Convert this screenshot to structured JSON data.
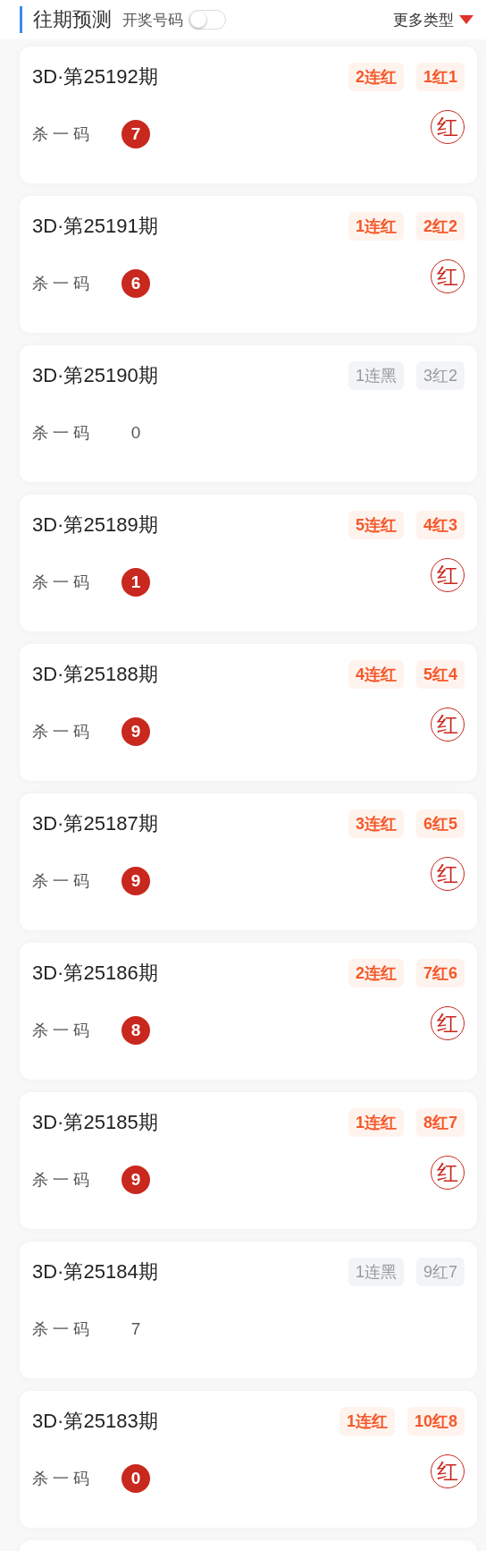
{
  "header": {
    "title": "往期预测",
    "toggle": {
      "label": "开奖号码",
      "on": false
    },
    "more_menu": "更多类型"
  },
  "cards": [
    {
      "title": "3D·第25192期",
      "badges": [
        "2连红",
        "1红1"
      ],
      "hit": true,
      "label": "杀 一 码",
      "number": "7",
      "stamp": "红"
    },
    {
      "title": "3D·第25191期",
      "badges": [
        "1连红",
        "2红2"
      ],
      "hit": true,
      "label": "杀 一 码",
      "number": "6",
      "stamp": "红"
    },
    {
      "title": "3D·第25190期",
      "badges": [
        "1连黑",
        "3红2"
      ],
      "hit": false,
      "label": "杀 一 码",
      "number": "0"
    },
    {
      "title": "3D·第25189期",
      "badges": [
        "5连红",
        "4红3"
      ],
      "hit": true,
      "label": "杀 一 码",
      "number": "1",
      "stamp": "红"
    },
    {
      "title": "3D·第25188期",
      "badges": [
        "4连红",
        "5红4"
      ],
      "hit": true,
      "label": "杀 一 码",
      "number": "9",
      "stamp": "红"
    },
    {
      "title": "3D·第25187期",
      "badges": [
        "3连红",
        "6红5"
      ],
      "hit": true,
      "label": "杀 一 码",
      "number": "9",
      "stamp": "红"
    },
    {
      "title": "3D·第25186期",
      "badges": [
        "2连红",
        "7红6"
      ],
      "hit": true,
      "label": "杀 一 码",
      "number": "8",
      "stamp": "红"
    },
    {
      "title": "3D·第25185期",
      "badges": [
        "1连红",
        "8红7"
      ],
      "hit": true,
      "label": "杀 一 码",
      "number": "9",
      "stamp": "红"
    },
    {
      "title": "3D·第25184期",
      "badges": [
        "1连黑",
        "9红7"
      ],
      "hit": false,
      "label": "杀 一 码",
      "number": "7"
    },
    {
      "title": "3D·第25183期",
      "badges": [
        "1连红",
        "10红8"
      ],
      "hit": true,
      "label": "杀 一 码",
      "number": "0",
      "stamp": "红"
    }
  ]
}
